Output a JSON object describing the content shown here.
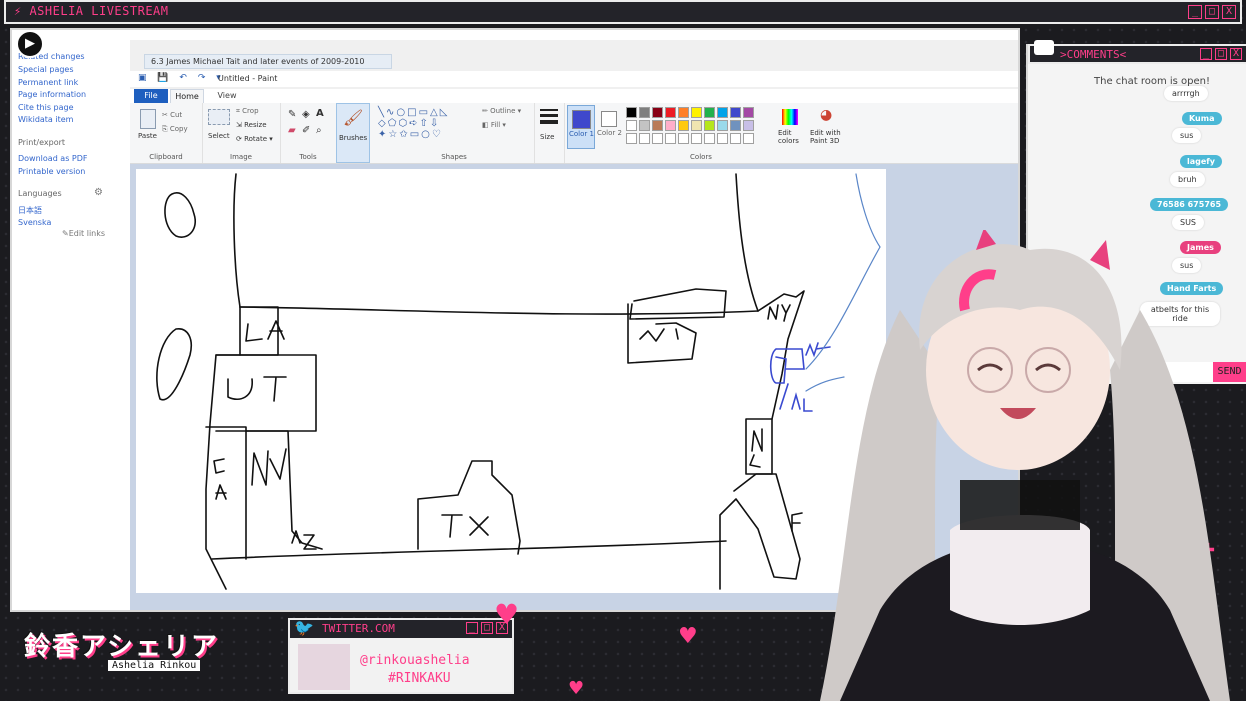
{
  "stream": {
    "title": "ASHELIA LIVESTREAM",
    "window_buttons": [
      "_",
      "□",
      "X"
    ]
  },
  "wiki_sidebar": {
    "links_top": [
      "Related changes",
      "Special pages",
      "Permanent link",
      "Page information",
      "Cite this page",
      "Wikidata item"
    ],
    "print_heading": "Print/export",
    "print_links": [
      "Download as PDF",
      "Printable version"
    ],
    "languages_heading": "Languages",
    "languages": [
      "日本語",
      "Svenska"
    ],
    "edit_links": "Edit links"
  },
  "paint": {
    "browser_tab": "6.3 James Michael Tait and later events of 2009-2010",
    "window_title": "Untitled - Paint",
    "menu": {
      "file": "File",
      "home": "Home",
      "view": "View"
    },
    "groups": {
      "clipboard": "Clipboard",
      "image": "Image",
      "tools": "Tools",
      "shapes": "Shapes",
      "colors": "Colors"
    },
    "buttons": {
      "paste": "Paste",
      "cut": "Cut",
      "copy": "Copy",
      "select": "Select",
      "crop": "Crop",
      "resize": "Resize",
      "rotate": "Rotate",
      "brushes": "Brushes",
      "outline": "Outline",
      "fill": "Fill",
      "size": "Size",
      "color1": "Color 1",
      "color2": "Color 2",
      "edit_colors": "Edit colors",
      "edit_paint3d": "Edit with Paint 3D"
    },
    "palette_row1": [
      "#000000",
      "#7f7f7f",
      "#880015",
      "#ed1c24",
      "#ff7f27",
      "#fff200",
      "#22b14c",
      "#00a2e8",
      "#3f48cc",
      "#a349a4"
    ],
    "palette_row2": [
      "#ffffff",
      "#c3c3c3",
      "#b97a57",
      "#ffaec9",
      "#ffc90e",
      "#efe4b0",
      "#b5e61d",
      "#99d9ea",
      "#7092be",
      "#c8bfe7"
    ],
    "active_color": "#3f48cc",
    "canvas_labels": [
      "LA",
      "UT",
      "CA",
      "NV",
      "AZ",
      "TX",
      "NY",
      "NJ",
      "NC",
      "F",
      "MA",
      "NL"
    ]
  },
  "chat": {
    "title": ">COMMENTS<",
    "open_message": "The chat room is open!",
    "messages": [
      {
        "name": "",
        "text": "arrrrgh",
        "color": ""
      },
      {
        "name": "Kuma",
        "text": "sus",
        "color": "#4bb8d6"
      },
      {
        "name": "lagefy",
        "text": "bruh",
        "color": "#4bb8d6"
      },
      {
        "name": "76586 675765",
        "text": "SUS",
        "color": "#4bb8d6"
      },
      {
        "name": "James",
        "text": "sus",
        "color": "#e8407e"
      },
      {
        "name": "Hand Farts",
        "text": "atbelts for this ride",
        "color": "#4bb8d6"
      }
    ],
    "send_label": "SEND"
  },
  "overlay": {
    "logo_jp": "鈴香アシェリア",
    "logo_en": "Ashelia Rinkou",
    "twitter_title": "TWITTER.COM",
    "twitter_handle": "@rinkouashelia",
    "twitter_tag": "#RINKAKU"
  },
  "colors": {
    "accent_pink": "#ff3e8a",
    "frame_dark": "#232329",
    "chat_name_blue": "#4bb8d6"
  }
}
